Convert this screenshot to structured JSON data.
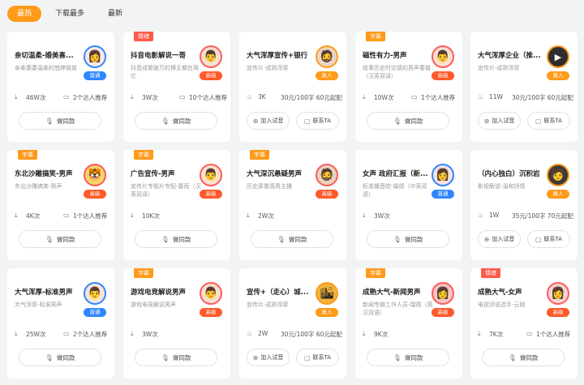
{
  "tabs": [
    "最热",
    "下载最多",
    "最新"
  ],
  "colors": {
    "accent": "#ff9a1a",
    "level_normal": "#2f86ff",
    "level_high": "#ff5a2a",
    "level_real": "#ff9a1a",
    "tag_blue": "#ff9a1a",
    "tag_red": "#ff5a4a"
  },
  "labels": {
    "listen": "做同款",
    "try": "加入试音",
    "contact": "联系TA"
  },
  "cards": [
    {
      "tag": "",
      "title": "亲切温柔-婚美喜...",
      "desc": "亲柔委委温柔的悠婷姐姐",
      "level": "普通",
      "dl": "46W次",
      "meta": "2个达人推荐",
      "price": "",
      "type": "wide"
    },
    {
      "tag": "情绪",
      "title": "抖音电影解说一哥",
      "desc": "抖音成聚破万的博主都在用它",
      "level": "高级",
      "dl": "3W次",
      "meta": "10个达人推荐",
      "price": "",
      "type": "wide"
    },
    {
      "tag": "",
      "title": "大气浑厚宣传+银行",
      "desc": "宣传片-成熟浑厚",
      "level": "真人",
      "dl": "3K",
      "meta": "",
      "price": "30元/100字 60元起配",
      "type": "split"
    },
    {
      "tag": "字幕",
      "title": "磁性有力-男声",
      "desc": "故事历史时空感的男声春雄（汉英双译）",
      "level": "高级",
      "dl": "10W次",
      "meta": "1个达人推荐",
      "price": "",
      "type": "wide"
    },
    {
      "tag": "",
      "title": "大气浑厚企业（推...",
      "desc": "宣传片-成熟浑厚",
      "level": "真人",
      "dl": "11W",
      "meta": "",
      "price": "30元/100字 60元起配",
      "type": "split"
    },
    {
      "tag": "字幕",
      "title": "东北沙雕搞笑-男声",
      "desc": "东北沙雕搞笑-男声",
      "level": "高级",
      "dl": "4K次",
      "meta": "1个达人推荐",
      "price": "",
      "type": "wide"
    },
    {
      "tag": "字幕",
      "title": "广告宣传-男声",
      "desc": "宣传片专题片专配-春雨（汉英双译）",
      "level": "高级",
      "dl": "10K次",
      "meta": "",
      "price": "",
      "type": "wide"
    },
    {
      "tag": "字幕",
      "title": "大气深沉悬疑男声",
      "desc": "历史厚重感男主播",
      "level": "高级",
      "dl": "2W次",
      "meta": "",
      "price": "",
      "type": "wide"
    },
    {
      "tag": "",
      "title": "女声 政府汇报（新...",
      "desc": "标准播音腔-端熠（中英双语）",
      "level": "普通",
      "dl": "3W次",
      "meta": "",
      "price": "",
      "type": "wide"
    },
    {
      "tag": "",
      "title": "（内心独白）沉积岩",
      "desc": "影视解说-温和抒情",
      "level": "真人",
      "dl": "1W",
      "meta": "",
      "price": "35元/100字 70元起配",
      "type": "split"
    },
    {
      "tag": "",
      "title": "大气浑厚-标准男声",
      "desc": "大气浑厚-标准男声",
      "level": "普通",
      "dl": "25W次",
      "meta": "2个达人推荐",
      "price": "",
      "type": "wide"
    },
    {
      "tag": "字幕",
      "title": "游戏电竞解说男声",
      "desc": "游戏电竞解说男声",
      "level": "高级",
      "dl": "3W次",
      "meta": "",
      "price": "",
      "type": "wide"
    },
    {
      "tag": "",
      "title": "宣传+（走心）城...",
      "desc": "宣传片-成熟浑厚",
      "level": "真人",
      "dl": "2W",
      "meta": "",
      "price": "30元/100字 60元起配",
      "type": "split"
    },
    {
      "tag": "字幕",
      "title": "成熟大气-新闻男声",
      "desc": "新闻专辑工作人员-瑞德（英汉双语）",
      "level": "高级",
      "dl": "9K次",
      "meta": "",
      "price": "",
      "type": "wide"
    },
    {
      "tag": "情绪",
      "title": "成熟大气-女声",
      "desc": "电视评说选手-云嫣",
      "level": "高级",
      "dl": "7K次",
      "meta": "1个达人推荐",
      "price": "",
      "type": "wide"
    }
  ]
}
